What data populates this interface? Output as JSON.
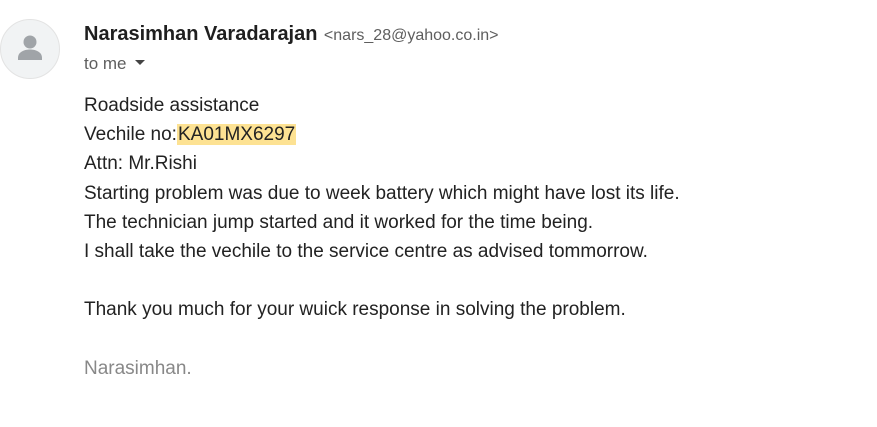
{
  "sender": {
    "name": "Narasimhan Varadarajan",
    "email": "<nars_28@yahoo.co.in>",
    "avatar_icon": "default-person-avatar-icon"
  },
  "recipient": {
    "label": "to me",
    "toggle_icon": "caret-down-icon"
  },
  "message": {
    "line1": "Roadside assistance",
    "line2_prefix": "Vechile no:",
    "line2_highlight": "KA01MX6297",
    "line3": "Attn: Mr.Rishi",
    "line4": "Starting problem was due to week battery which might have lost its life.",
    "line5": "The technician jump started and it worked for the time being.",
    "line6": "I shall take the vechile to the service centre as advised tommorrow.",
    "line7": "Thank you much for your wuick response in solving the problem.",
    "signature": "Narasimhan."
  },
  "colors": {
    "highlight": "#fde293",
    "signature": "#888888",
    "muted": "#5e5e5e"
  }
}
